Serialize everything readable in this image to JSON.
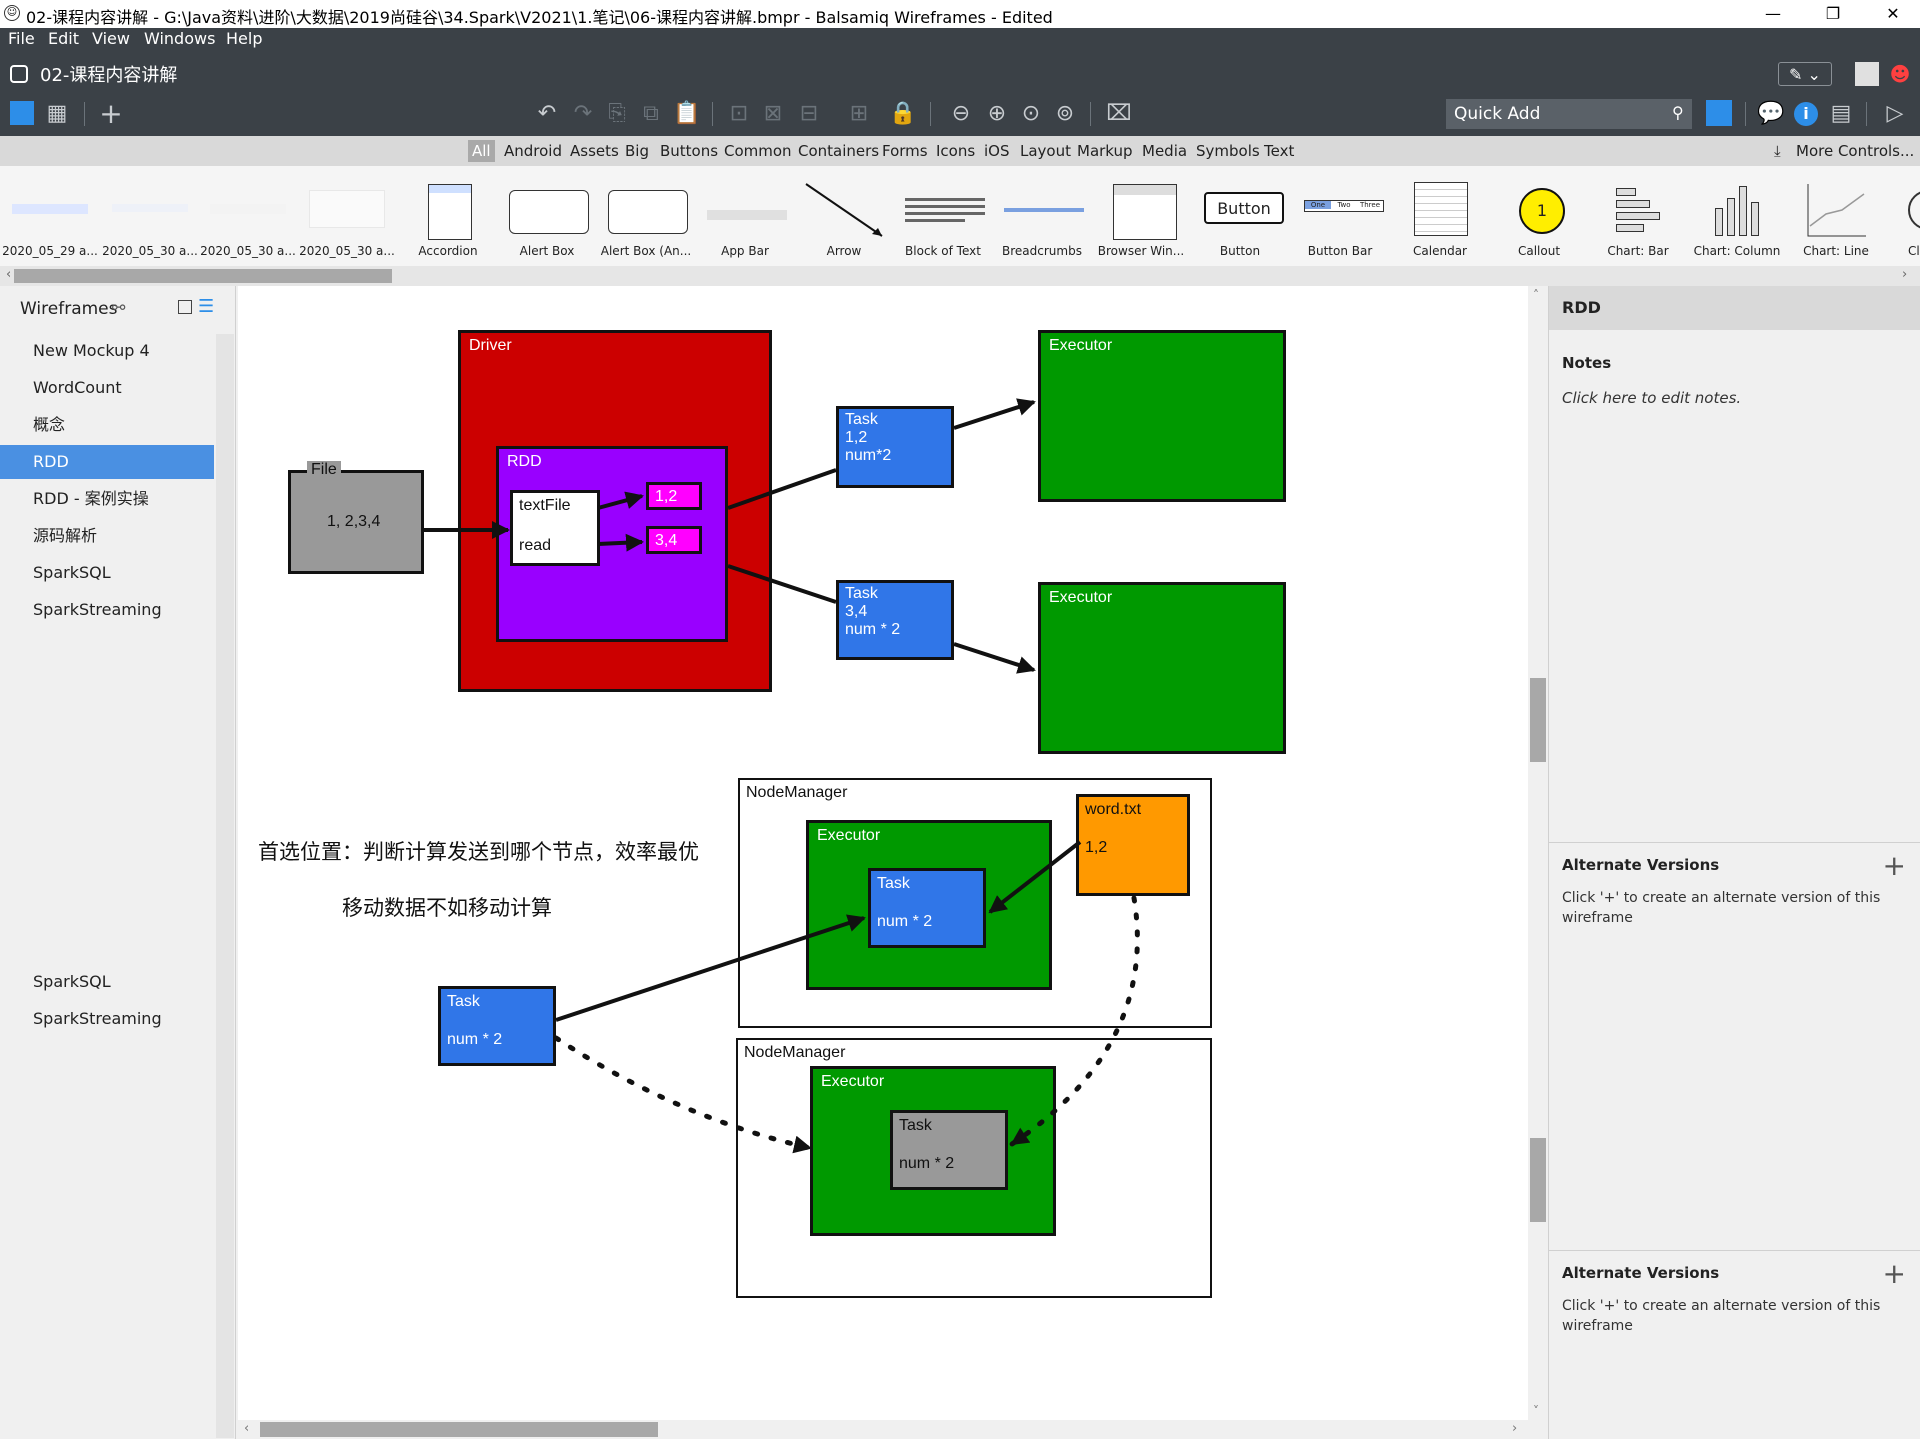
{
  "window": {
    "title": "02-课程内容讲解 - G:\\Java资料\\进阶\\大数据\\2019尚硅谷\\34.Spark\\V2021\\1.笔记\\06-课程内容讲解.bmpr - Balsamiq Wireframes - Edited",
    "minimize": "—",
    "restore": "❐",
    "close": "✕"
  },
  "menu": [
    "File",
    "Edit",
    "View",
    "Windows",
    "Help"
  ],
  "doc_tab": {
    "title": "02-课程内容讲解"
  },
  "quick_add": {
    "placeholder": "Quick Add"
  },
  "library": {
    "categories": [
      "All",
      "Android",
      "Assets",
      "Big",
      "Buttons",
      "Common",
      "Containers",
      "Forms",
      "Icons",
      "iOS",
      "Layout",
      "Markup",
      "Media",
      "Symbols",
      "Text"
    ],
    "selected": "All",
    "more_controls": "More Controls...",
    "items": [
      "2020_05_29 a...",
      "2020_05_30 a...",
      "2020_05_30 a...",
      "2020_05_30 a...",
      "Accordion",
      "Alert Box",
      "Alert Box (An...",
      "App Bar",
      "Arrow",
      "Block of Text",
      "Breadcrumbs",
      "Browser Win...",
      "Button",
      "Button Bar",
      "Calendar",
      "Callout",
      "Chart: Bar",
      "Chart: Column",
      "Chart: Line",
      "Cl"
    ],
    "thumb_button_text": "Button",
    "thumb_callout_text": "1",
    "thumb_buttonbar": [
      "One",
      "Two",
      "Three"
    ]
  },
  "left_panel": {
    "title": "Wireframes",
    "items": [
      "New Mockup 4",
      "WordCount",
      "概念",
      "RDD",
      "RDD - 案例实操",
      "源码解析",
      "SparkSQL",
      "SparkStreaming"
    ],
    "selected": "RDD",
    "extra_items": [
      "SparkSQL",
      "SparkStreaming"
    ]
  },
  "canvas": {
    "file": {
      "title": "File",
      "content": "1, 2,3,4"
    },
    "driver": {
      "title": "Driver"
    },
    "rdd": {
      "title": "RDD",
      "textfile": "textFile",
      "read": "read",
      "p1": "1,2",
      "p2": "3,4"
    },
    "task1": {
      "l1": "Task",
      "l2": "1,2",
      "l3": "num*2"
    },
    "task2": {
      "l1": "Task",
      "l2": "3,4",
      "l3": "num * 2"
    },
    "executor1": "Executor",
    "executor2": "Executor",
    "note1": "首选位置：判断计算发送到哪个节点，效率最优",
    "note2": "移动数据不如移动计算",
    "nm1": {
      "title": "NodeManager",
      "executor": "Executor",
      "task_l1": "Task",
      "task_l2": "num * 2"
    },
    "wordtxt": {
      "title": "word.txt",
      "content": "1,2"
    },
    "task3": {
      "l1": "Task",
      "l2": "num * 2"
    },
    "nm2": {
      "title": "NodeManager",
      "executor": "Executor",
      "task_l1": "Task",
      "task_l2": "num * 2"
    }
  },
  "right_panel": {
    "title": "RDD",
    "notes_title": "Notes",
    "notes_placeholder": "Click here to edit notes.",
    "alt_title": "Alternate Versions",
    "alt_text": "Click '+' to create an alternate version of this wireframe",
    "alt_title_2": "Alternate Versions",
    "alt_text_2": "Click '+' to create an alternate version of this wireframe",
    "plus": "+"
  },
  "colors": {
    "chrome_dark": "#3b4147",
    "driver_red": "#cc0000",
    "rdd_purple": "#9900ff",
    "task_blue": "#3076e8",
    "executor_green": "#009900",
    "partition_magenta": "#ff00ff",
    "word_orange": "#ff9900",
    "file_gray": "#999999",
    "selection_blue": "#4a90e2"
  }
}
